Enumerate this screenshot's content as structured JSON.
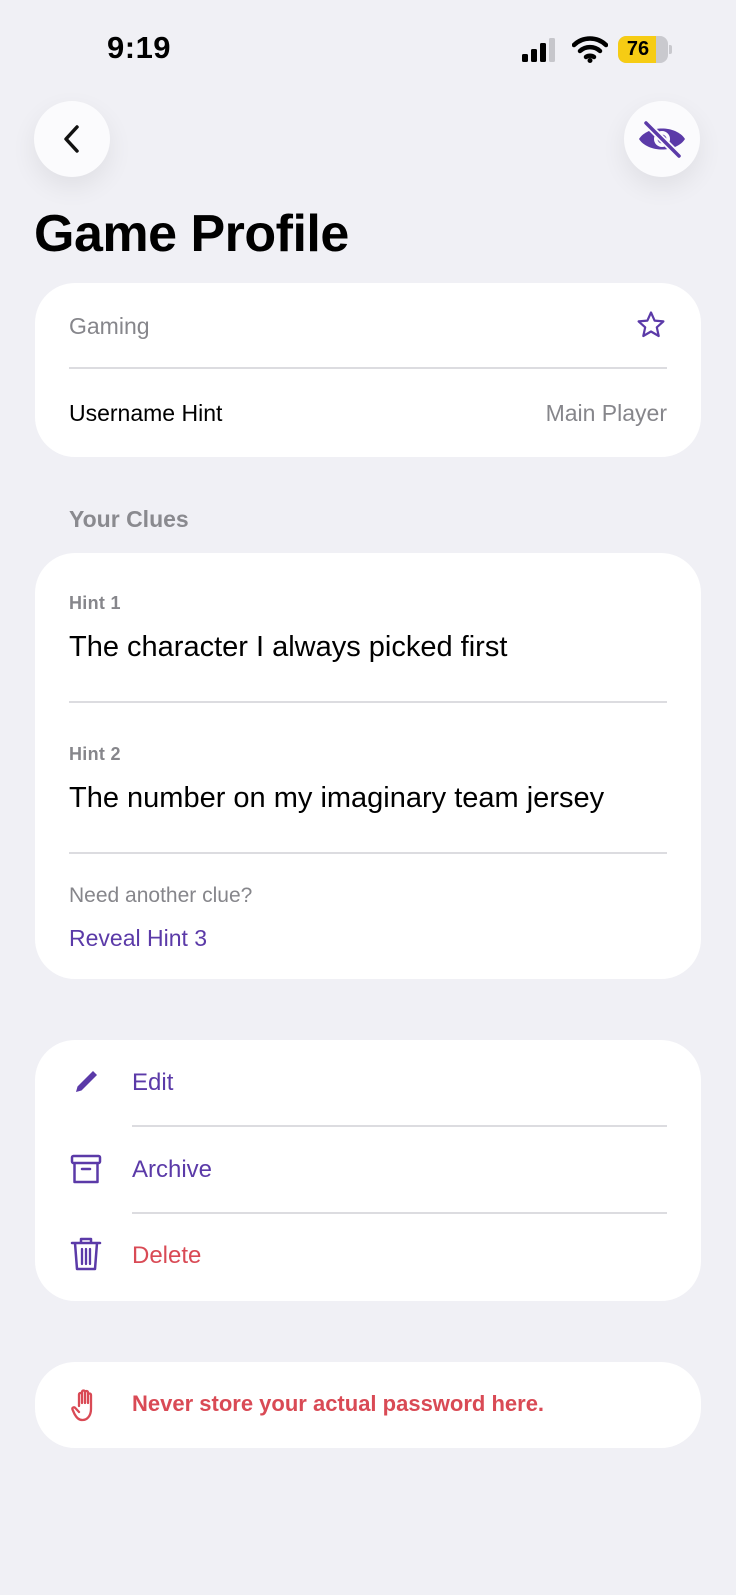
{
  "status_bar": {
    "time": "9:19",
    "battery": "76",
    "battery_level": 0.76
  },
  "nav": {
    "back_icon": "chevron-left-icon",
    "visibility_icon": "eye-slash-icon"
  },
  "title": "Game Profile",
  "info_card": {
    "category": "Gaming",
    "favorite_icon": "star-icon",
    "username_label": "Username Hint",
    "username_value": "Main Player"
  },
  "clues": {
    "header": "Your Clues",
    "items": [
      {
        "label": "Hint 1",
        "text": "The character I always picked first"
      },
      {
        "label": "Hint 2",
        "text": "The number on my imaginary team jersey"
      }
    ],
    "more_prompt": "Need another clue?",
    "reveal_label": "Reveal Hint 3"
  },
  "actions": {
    "edit": "Edit",
    "archive": "Archive",
    "delete": "Delete"
  },
  "warning": {
    "icon": "hand-stop-icon",
    "text": "Never store your actual password here."
  },
  "colors": {
    "accent": "#5b3aa8",
    "danger": "#d94a55",
    "background": "#f0f0f5",
    "battery": "#f6cc14"
  }
}
